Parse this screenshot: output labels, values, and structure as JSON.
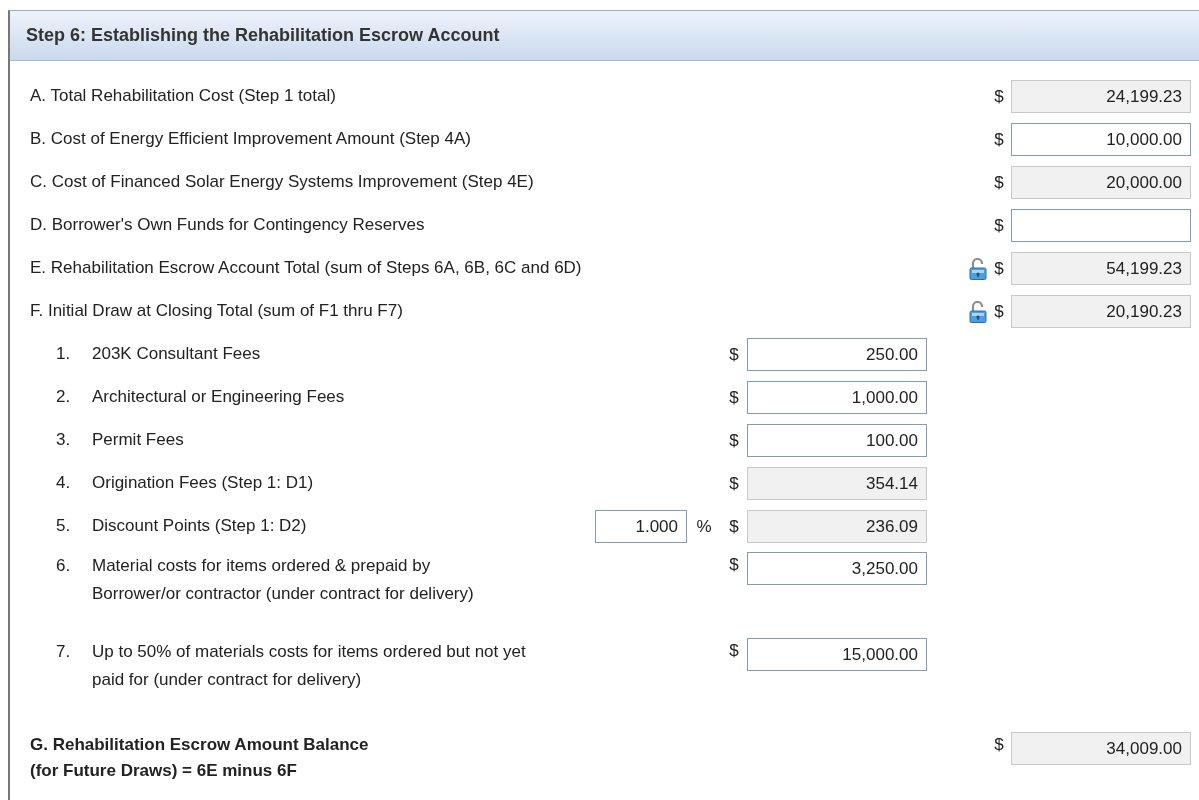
{
  "panel": {
    "title": "Step 6: Establishing the Rehabilitation Escrow Account"
  },
  "rows": [
    {
      "kind": "main",
      "label_lines": [
        "A. Total Rehabilitation Cost (Step 1 total)"
      ],
      "currency": "$",
      "value": "24,199.23",
      "readonly": true,
      "locked": false
    },
    {
      "kind": "main",
      "label_lines": [
        "B. Cost of Energy Efficient Improvement Amount (Step 4A)"
      ],
      "currency": "$",
      "value": "10,000.00",
      "readonly": false,
      "locked": false
    },
    {
      "kind": "main",
      "label_lines": [
        "C. Cost of Financed Solar Energy Systems Improvement (Step 4E)"
      ],
      "currency": "$",
      "value": "20,000.00",
      "readonly": true,
      "locked": false
    },
    {
      "kind": "main",
      "label_lines": [
        "D. Borrower's Own Funds for Contingency Reserves"
      ],
      "currency": "$",
      "readonly": false,
      "locked": false
    },
    {
      "kind": "main",
      "label_lines": [
        "E. Rehabilitation Escrow Account Total (sum of Steps 6A, 6B, 6C and 6D)"
      ],
      "currency": "$",
      "value": "54,199.23",
      "readonly": true,
      "locked": true
    },
    {
      "kind": "main",
      "label_lines": [
        "F. Initial Draw at Closing Total (sum of F1 thru F7)"
      ],
      "currency": "$",
      "value": "20,190.23",
      "readonly": true,
      "locked": true
    },
    {
      "kind": "sub",
      "number": "1.",
      "label_lines": [
        "203K Consultant Fees"
      ],
      "currency": "$",
      "value": "250.00",
      "readonly": false
    },
    {
      "kind": "sub",
      "number": "2.",
      "label_lines": [
        "Architectural or Engineering Fees"
      ],
      "currency": "$",
      "value": "1,000.00",
      "readonly": false
    },
    {
      "kind": "sub",
      "number": "3.",
      "label_lines": [
        "Permit Fees"
      ],
      "currency": "$",
      "value": "100.00",
      "readonly": false
    },
    {
      "kind": "sub",
      "number": "4.",
      "label_lines": [
        "Origination Fees (Step 1: D1)"
      ],
      "currency": "$",
      "value": "354.14",
      "readonly": true
    },
    {
      "kind": "sub",
      "number": "5.",
      "label_lines": [
        "Discount Points (Step 1: D2)"
      ],
      "percent": "1.000",
      "percent_sign": "%",
      "currency": "$",
      "value": "236.09",
      "readonly": true
    },
    {
      "kind": "sub",
      "number": "6.",
      "label_lines": [
        "Material costs for items ordered & prepaid by",
        "Borrower/or contractor (under contract for delivery)"
      ],
      "currency": "$",
      "value": "3,250.00",
      "readonly": false
    },
    {
      "kind": "sub",
      "number": "7.",
      "label_lines": [
        "Up to 50% of materials costs for items ordered but not yet",
        "paid for (under contract for delivery)"
      ],
      "currency": "$",
      "value": "15,000.00",
      "readonly": false
    },
    {
      "kind": "total",
      "label_lines": [
        "G. Rehabilitation Escrow Amount Balance",
        "(for Future Draws) = 6E minus 6F"
      ],
      "currency": "$",
      "value": "34,009.00",
      "readonly": true,
      "locked": false
    }
  ]
}
